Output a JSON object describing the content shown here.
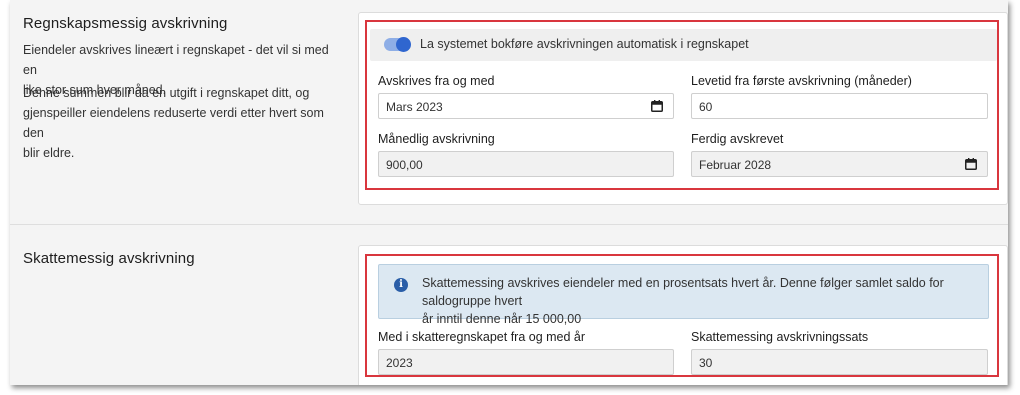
{
  "accounting": {
    "title": "Regnskapsmessig avskrivning",
    "desc1_line1": "Eiendeler avskrives lineært i regnskapet - det vil si med en",
    "desc1_line2": "like stor sum hver måned.",
    "desc2_line1": "Denne summen blir da en utgift i regnskapet ditt, og",
    "desc2_line2": "gjenspeiller eiendelens reduserte verdi etter hvert som den",
    "desc2_line3": "blir eldre.",
    "toggle_label": "La systemet bokføre avskrivningen automatisk i regnskapet",
    "toggle_on": true,
    "from_label": "Avskrives fra og med",
    "from_value": "Mars 2023",
    "lifetime_label": "Levetid fra første avskrivning (måneder)",
    "lifetime_value": "60",
    "monthly_label": "Månedlig avskrivning",
    "monthly_value": "900,00",
    "done_label": "Ferdig avskrevet",
    "done_value": "Februar 2028"
  },
  "tax": {
    "title": "Skattemessig avskrivning",
    "info_line1": "Skattemessing avskrives eiendeler med en prosentsats hvert år. Denne følger samlet saldo for saldogruppe hvert",
    "info_line2": "år inntil denne når 15 000,00",
    "year_label": "Med i skatteregnskapet fra og med år",
    "year_value": "2023",
    "rate_label": "Skattemessing avskrivningssats",
    "rate_value": "30"
  },
  "colors": {
    "highlight": "#d9363e",
    "accent": "#2f66cf",
    "info_bg": "#dce8f2"
  },
  "icons": {
    "calendar": "calendar-icon",
    "info": "info-icon"
  }
}
